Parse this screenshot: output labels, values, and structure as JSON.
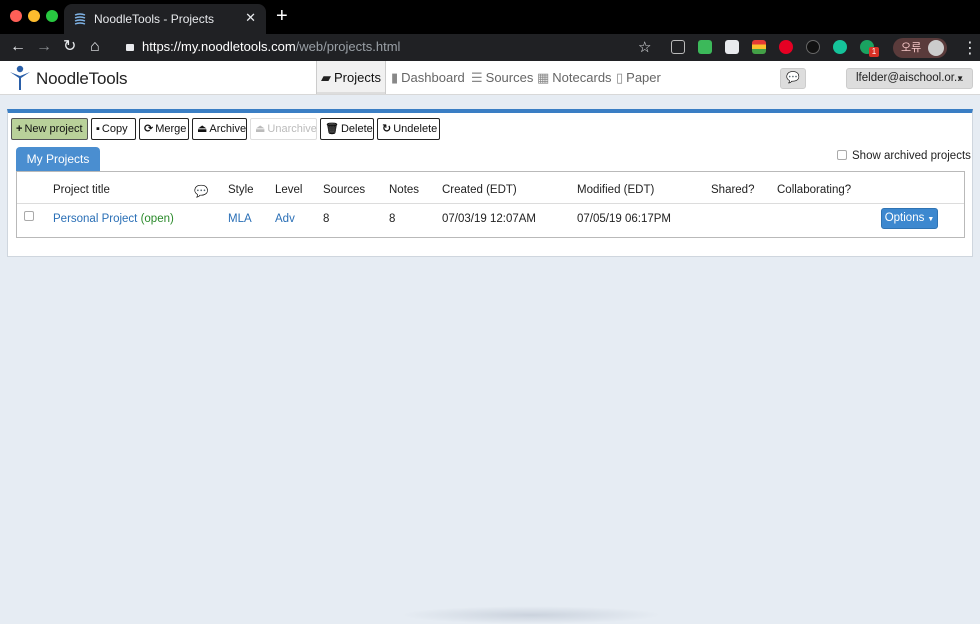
{
  "browser": {
    "tab_title": "NoodleTools - Projects",
    "tab_close": "✕",
    "new_tab": "+",
    "url_host": "https://my.noodletools.com",
    "url_path": "/web/projects.html",
    "profile_text": "오류",
    "ext_badge": "1",
    "back": "←",
    "forward": "→",
    "reload": "↻",
    "home": "⌂",
    "star": "☆",
    "menu": "⋮"
  },
  "app": {
    "brand": "NoodleTools",
    "nav": [
      {
        "label": "Projects",
        "icon": "folder-open-icon",
        "glyph": "▰"
      },
      {
        "label": "Dashboard",
        "icon": "bar-chart-icon",
        "glyph": "▮"
      },
      {
        "label": "Sources",
        "icon": "list-icon",
        "glyph": "☰"
      },
      {
        "label": "Notecards",
        "icon": "grid-icon",
        "glyph": "▦"
      },
      {
        "label": "Paper",
        "icon": "document-icon",
        "glyph": "▯"
      }
    ],
    "chat_glyph": "💬",
    "user": "lfelder@aischool.or...",
    "user_caret": "▼"
  },
  "actions": {
    "new_project": "New project",
    "copy": "Copy",
    "merge": "Merge",
    "archive": "Archive",
    "unarchive": "Unarchive",
    "delete": "Delete",
    "undelete": "Undelete",
    "plus_glyph": "+",
    "copy_glyph": "▪",
    "merge_glyph": "⟳",
    "archive_glyph": "⏏",
    "unarchive_glyph": "⏏",
    "delete_glyph": "🗑",
    "undelete_glyph": "↻"
  },
  "projects": {
    "tab_label": "My Projects",
    "show_archived": "Show archived projects",
    "columns": {
      "title": "Project title",
      "comments_glyph": "💬",
      "style": "Style",
      "level": "Level",
      "sources": "Sources",
      "notes": "Notes",
      "created": "Created (EDT)",
      "modified": "Modified (EDT)",
      "shared": "Shared?",
      "collaborating": "Collaborating?"
    },
    "rows": [
      {
        "title": "Personal Project",
        "status": "(open)",
        "style": "MLA",
        "level": "Adv",
        "sources": "8",
        "notes": "8",
        "created": "07/03/19 12:07AM",
        "modified": "07/05/19 06:17PM",
        "options": "Options",
        "options_caret": "▼"
      }
    ]
  },
  "colors": {
    "accent_blue": "#3a7ec4",
    "primary_button": "#b9d19a",
    "link": "#2a6fb6",
    "open_status": "#2a8a2a"
  }
}
